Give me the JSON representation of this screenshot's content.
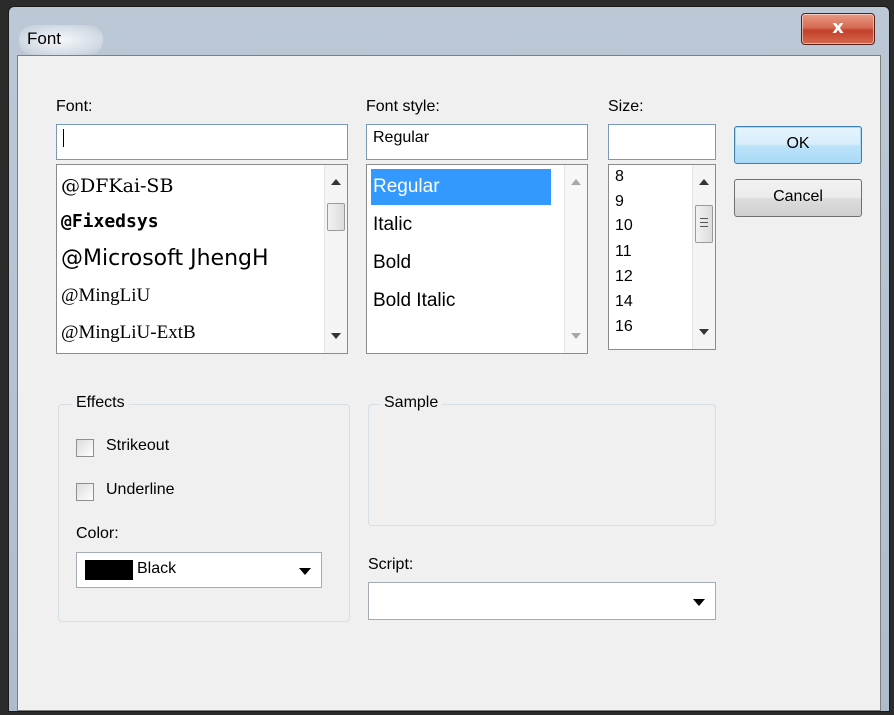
{
  "window": {
    "title": "Font",
    "close_glyph": "x"
  },
  "font": {
    "label": "Font:",
    "value": "",
    "items": [
      "@DFKai-SB",
      "@Fixedsys",
      "@Microsoft JhengH",
      "@MingLiU",
      "@MingLiU-ExtB"
    ]
  },
  "font_style": {
    "label": "Font style:",
    "value": "Regular",
    "items": [
      "Regular",
      "Italic",
      "Bold",
      "Bold Italic"
    ],
    "selected": "Regular"
  },
  "size": {
    "label": "Size:",
    "value": "",
    "items": [
      "8",
      "9",
      "10",
      "11",
      "12",
      "14",
      "16"
    ]
  },
  "buttons": {
    "ok": "OK",
    "cancel": "Cancel"
  },
  "effects": {
    "title": "Effects",
    "strikeout": "Strikeout",
    "underline": "Underline",
    "strikeout_checked": false,
    "underline_checked": false,
    "color_label": "Color:",
    "color_value": "Black",
    "color_swatch": "#000000"
  },
  "sample": {
    "title": "Sample"
  },
  "script": {
    "label": "Script:",
    "value": ""
  },
  "colors": {
    "selection": "#3399ff",
    "close_button": "#c2402a",
    "default_button_border": "#3c7fb1"
  },
  "icons": {
    "close": "close-icon",
    "scroll_up": "scroll-up-icon",
    "scroll_down": "scroll-down-icon",
    "dropdown": "chevron-down-icon"
  }
}
